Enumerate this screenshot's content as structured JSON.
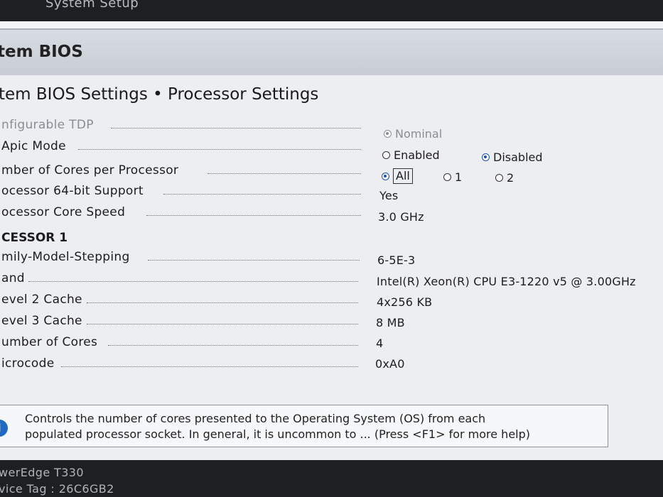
{
  "top": {
    "title": "System Setup"
  },
  "header": {
    "title": "tem BIOS"
  },
  "page": {
    "title": "tem BIOS Settings • Processor Settings"
  },
  "settings": [
    {
      "label": "nfigurable TDP",
      "type": "radio",
      "muted": true,
      "options": [
        {
          "label": "Nominal",
          "selected": true
        }
      ]
    },
    {
      "label": "Apic Mode",
      "type": "radio",
      "options": [
        {
          "label": "Enabled",
          "selected": false
        },
        {
          "label": "Disabled",
          "selected": true
        }
      ]
    },
    {
      "label": "mber of Cores per Processor",
      "type": "radio",
      "options": [
        {
          "label": "All",
          "selected": true
        },
        {
          "label": "1",
          "selected": false
        },
        {
          "label": "2",
          "selected": false
        }
      ]
    },
    {
      "label": "ocessor 64-bit Support",
      "value": "Yes"
    },
    {
      "label": "ocessor Core Speed",
      "value": "3.0 GHz"
    }
  ],
  "section": {
    "title": "CESSOR 1"
  },
  "processor": [
    {
      "label": "mily-Model-Stepping",
      "value": "6-5E-3"
    },
    {
      "label": "and",
      "value": "Intel(R) Xeon(R) CPU E3-1220 v5 @ 3.00GHz"
    },
    {
      "label": "evel 2 Cache",
      "value": "4x256 KB"
    },
    {
      "label": "evel 3 Cache",
      "value": "8 MB"
    },
    {
      "label": "umber of Cores",
      "value": "4"
    },
    {
      "label": "icrocode",
      "value": "0xA0"
    }
  ],
  "help": {
    "icon": "info-icon",
    "line1": "Controls the number of cores presented to the Operating System (OS) from each",
    "line2": "populated processor socket. In general, it is uncommon to ... (Press <F1> for more help)"
  },
  "footer": {
    "model": "werEdge T330",
    "service_tag": "vice Tag : 26C6GB2"
  }
}
